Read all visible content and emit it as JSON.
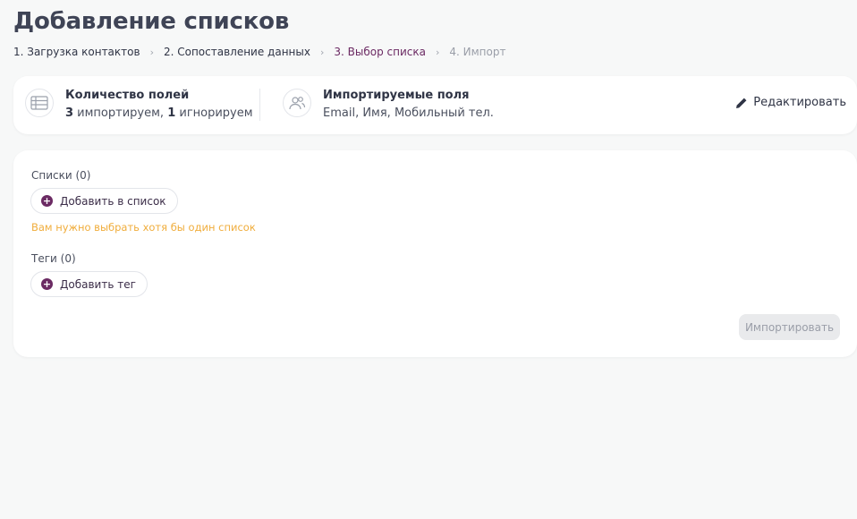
{
  "page": {
    "title": "Добавление списков"
  },
  "breadcrumb": [
    {
      "label": "1. Загрузка контактов",
      "state": "done"
    },
    {
      "label": "2. Сопоставление данных",
      "state": "done"
    },
    {
      "label": "3. Выбор списка",
      "state": "active"
    },
    {
      "label": "4. Импорт",
      "state": "future"
    }
  ],
  "summary": {
    "fields_count": {
      "icon": "table-icon",
      "title": "Количество полей",
      "imported_count": "3",
      "imported_text": " импортируем, ",
      "ignored_count": "1",
      "ignored_text": " игнорируем"
    },
    "imported_fields": {
      "icon": "users-icon",
      "title": "Импортируемые поля",
      "value": "Email, Имя, Мобильный тел."
    },
    "edit": {
      "icon": "pencil-icon",
      "label": "Редактировать"
    }
  },
  "lists": {
    "label": "Списки (0)",
    "add_label": "Добавить в список",
    "warning": "Вам нужно выбрать хотя бы один список"
  },
  "tags": {
    "label": "Теги (0)",
    "add_label": "Добавить тег"
  },
  "actions": {
    "import_label": "Импортировать"
  },
  "colors": {
    "accent": "#6b2a63",
    "warning": "#f0ad3c",
    "disabled_bg": "#e9eaec",
    "disabled_text": "#9a9ea8"
  }
}
